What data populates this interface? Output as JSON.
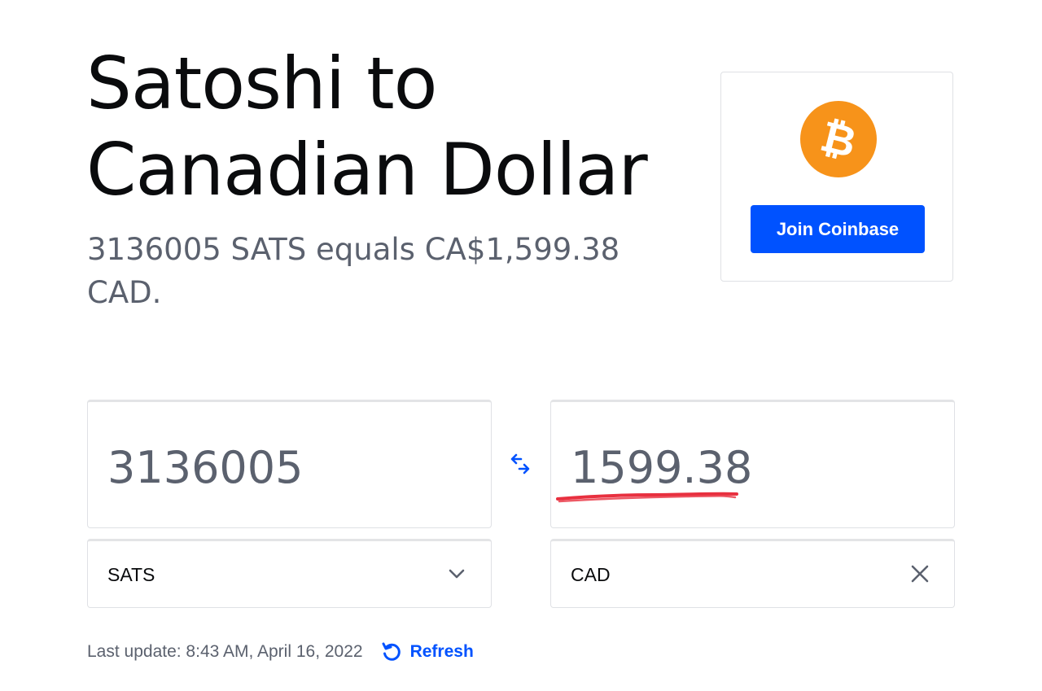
{
  "heading": {
    "title": "Satoshi to Canadian Dollar",
    "summary": "3136005 SATS equals CA$1,599.38 CAD."
  },
  "promo": {
    "logo_icon": "bitcoin-icon",
    "logo_symbol": "₿",
    "logo_color": "#f7931a",
    "button_label": "Join Coinbase",
    "button_color": "#0052ff"
  },
  "converter": {
    "from_amount": "3136005",
    "to_amount": "1599.38",
    "from_currency": "SATS",
    "to_currency": "CAD",
    "swap_icon": "swap-arrows-icon",
    "from_select_icon": "chevron-down-icon",
    "to_select_icon": "close-icon"
  },
  "footer": {
    "last_update": "Last update: 8:43 AM, April 16, 2022",
    "refresh_label": "Refresh",
    "refresh_icon": "refresh-icon"
  }
}
